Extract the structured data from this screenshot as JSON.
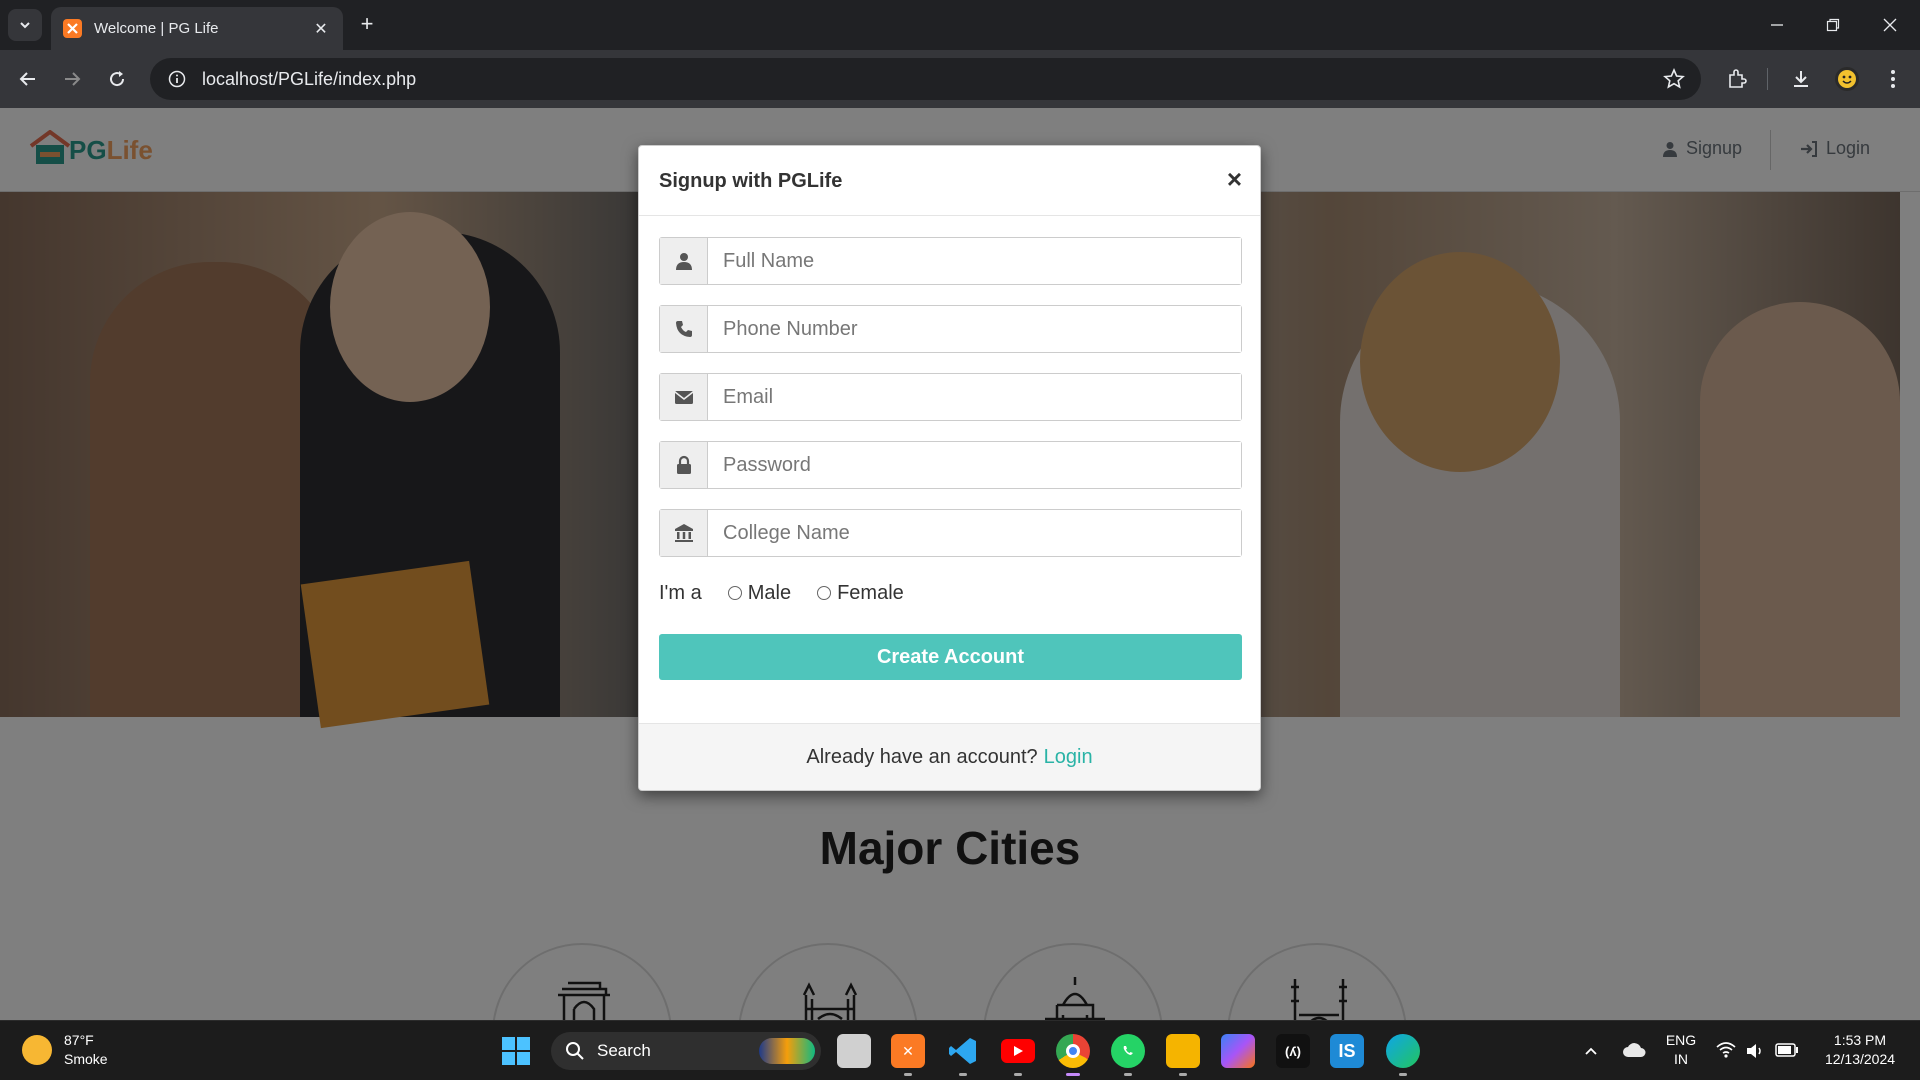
{
  "browser": {
    "tab_title": "Welcome | PG Life",
    "url": "localhost/PGLife/index.php"
  },
  "site": {
    "logo_prefix": "PG",
    "logo_suffix": "Life",
    "nav": {
      "signup": "Signup",
      "login": "Login"
    },
    "section_title": "Major Cities"
  },
  "modal": {
    "title": "Signup with PGLife",
    "close": "×",
    "fields": [
      {
        "placeholder": "Full Name",
        "icon": "user-icon"
      },
      {
        "placeholder": "Phone Number",
        "icon": "phone-icon"
      },
      {
        "placeholder": "Email",
        "icon": "envelope-icon"
      },
      {
        "placeholder": "Password",
        "icon": "lock-icon"
      },
      {
        "placeholder": "College Name",
        "icon": "bank-icon"
      }
    ],
    "gender_label": "I'm a",
    "gender_options": [
      "Male",
      "Female"
    ],
    "submit": "Create Account",
    "footer_text": "Already have an account?",
    "footer_link": "Login"
  },
  "taskbar": {
    "temperature": "87°F",
    "weather": "Smoke",
    "search": "Search",
    "lang": "ENG",
    "region": "IN",
    "time": "1:53 PM",
    "date": "12/13/2024"
  },
  "colors": {
    "accent": "#4fc5bb",
    "link": "#2ab3a6",
    "chrome_dark": "#202124",
    "chrome_tab": "#35363a"
  }
}
